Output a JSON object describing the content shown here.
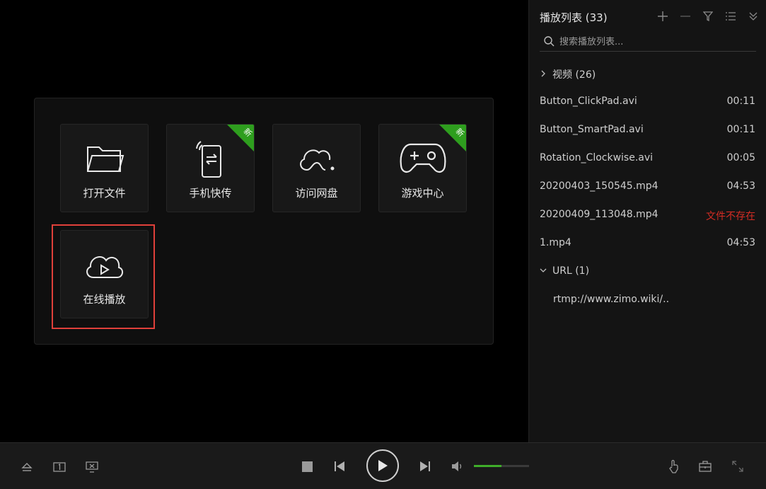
{
  "tiles": [
    {
      "label": "打开文件",
      "icon": "folder-icon",
      "badge": null
    },
    {
      "label": "手机快传",
      "icon": "phone-transfer-icon",
      "badge": "新"
    },
    {
      "label": "访问网盘",
      "icon": "cloud-icon",
      "badge": null
    },
    {
      "label": "游戏中心",
      "icon": "gamepad-icon",
      "badge": "新"
    },
    {
      "label": "在线播放",
      "icon": "cloud-play-icon",
      "badge": null
    }
  ],
  "playlist": {
    "title": "播放列表 (33)",
    "search_placeholder": "搜索播放列表...",
    "toolbar_icons": [
      "plus-icon",
      "minus-icon",
      "filter-icon",
      "list-icon",
      "collapse-icon"
    ],
    "groups": [
      {
        "label": "视频 (26)",
        "expanded": false
      },
      {
        "label": "URL (1)",
        "expanded": true
      }
    ],
    "items": [
      {
        "name": "Button_ClickPad.avi",
        "duration": "00:11"
      },
      {
        "name": "Button_SmartPad.avi",
        "duration": "00:11"
      },
      {
        "name": "Rotation_Clockwise.avi",
        "duration": "00:05"
      },
      {
        "name": "20200403_150545.mp4",
        "duration": "04:53"
      },
      {
        "name": "20200409_113048.mp4",
        "duration": "文件不存在"
      },
      {
        "name": "1.mp4",
        "duration": "04:53"
      }
    ],
    "url_items": [
      {
        "name": "rtmp://www.zimo.wiki/.."
      }
    ]
  },
  "controls": {
    "left_icons": [
      "eject-icon",
      "screen-one-icon",
      "screenshot-icon"
    ],
    "center_icons": [
      "stop-icon",
      "previous-icon",
      "play-icon",
      "next-icon",
      "volume-icon"
    ],
    "right_icons": [
      "gesture-icon",
      "toolbox-icon",
      "fullscreen-icon"
    ],
    "volume_level": 0.5
  },
  "colors": {
    "accent_green": "#3fae2a",
    "error_red": "#d42c24",
    "highlight_red": "#e0403a"
  }
}
